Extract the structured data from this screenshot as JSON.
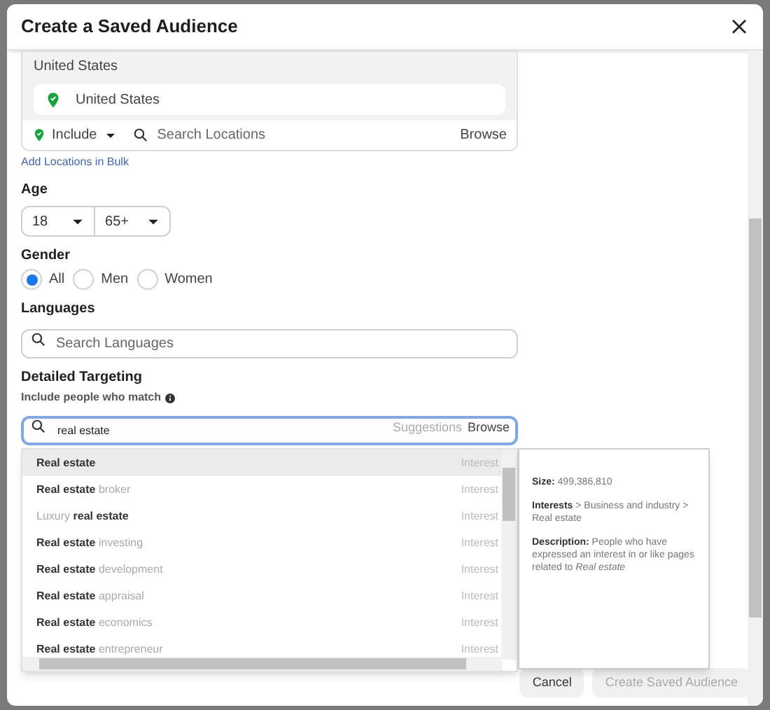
{
  "dialog": {
    "title": "Create a Saved Audience"
  },
  "locations": {
    "group_label": "United States",
    "selected": [
      {
        "name": "United States"
      }
    ],
    "mode": "Include",
    "search_placeholder": "Search Locations",
    "browse": "Browse",
    "bulk_link": "Add Locations in Bulk"
  },
  "age": {
    "label": "Age",
    "min": "18",
    "max": "65+"
  },
  "gender": {
    "label": "Gender",
    "options": [
      {
        "label": "All",
        "selected": true
      },
      {
        "label": "Men",
        "selected": false
      },
      {
        "label": "Women",
        "selected": false
      }
    ]
  },
  "languages": {
    "label": "Languages",
    "placeholder": "Search Languages"
  },
  "detailed_targeting": {
    "label": "Detailed Targeting",
    "hint": "Include people who match",
    "value": "real estate",
    "suggestions": "Suggestions",
    "browse": "Browse"
  },
  "results": [
    {
      "parts": [
        {
          "text": "Real estate",
          "matched": true
        }
      ],
      "type": "Interest",
      "selected": true
    },
    {
      "parts": [
        {
          "text": "Real estate",
          "matched": true
        },
        {
          "text": "broker",
          "matched": false
        }
      ],
      "type": "Interest",
      "selected": false
    },
    {
      "parts": [
        {
          "text": "Luxury",
          "matched": false
        },
        {
          "text": "real estate",
          "matched": true
        }
      ],
      "type": "Interest",
      "selected": false
    },
    {
      "parts": [
        {
          "text": "Real estate",
          "matched": true
        },
        {
          "text": "investing",
          "matched": false
        }
      ],
      "type": "Interest",
      "selected": false
    },
    {
      "parts": [
        {
          "text": "Real estate",
          "matched": true
        },
        {
          "text": "development",
          "matched": false
        }
      ],
      "type": "Interest",
      "selected": false
    },
    {
      "parts": [
        {
          "text": "Real estate",
          "matched": true
        },
        {
          "text": "appraisal",
          "matched": false
        }
      ],
      "type": "Interest",
      "selected": false
    },
    {
      "parts": [
        {
          "text": "Real estate",
          "matched": true
        },
        {
          "text": "economics",
          "matched": false
        }
      ],
      "type": "Interest",
      "selected": false
    },
    {
      "parts": [
        {
          "text": "Real estate",
          "matched": true
        },
        {
          "text": "entrepreneur",
          "matched": false
        }
      ],
      "type": "Interest",
      "selected": false
    }
  ],
  "details": {
    "size": "**Size:** 499,386,810",
    "path": "**Interests** > Business and industry > Real estate",
    "description": "**Description:** People who have expressed an interest in or like pages related to *Real estate*"
  },
  "buttons": [
    {
      "label": "Cancel",
      "disabled": false
    },
    {
      "label": "Create Saved Audience",
      "disabled": true
    }
  ]
}
